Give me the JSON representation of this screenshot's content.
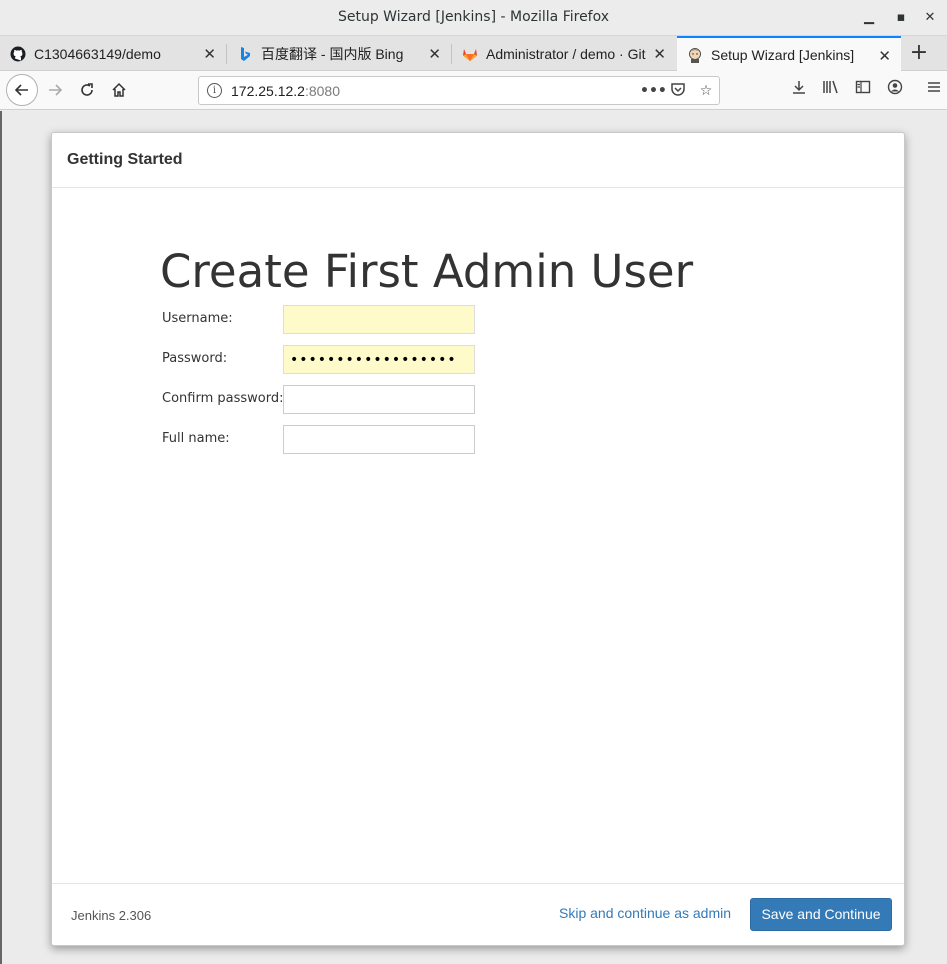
{
  "window": {
    "title": "Setup Wizard [Jenkins] - Mozilla Firefox"
  },
  "tabs": [
    {
      "label": "C1304663149/demo",
      "icon": "github-icon"
    },
    {
      "label": "百度翻译 - 国内版 Bing",
      "icon": "bing-icon"
    },
    {
      "label": "Administrator / demo · Git",
      "icon": "gitlab-icon"
    },
    {
      "label": "Setup Wizard [Jenkins]",
      "icon": "jenkins-icon",
      "active": true
    }
  ],
  "navbar": {
    "url_host": "172.25.12.2",
    "url_port": ":8080"
  },
  "page": {
    "header": "Getting Started",
    "heading": "Create First Admin User",
    "fields": {
      "username_label": "Username:",
      "password_label": "Password:",
      "password_value": "••••••••••••••••••",
      "confirm_label": "Confirm password:",
      "fullname_label": "Full name:"
    },
    "footer": {
      "version": "Jenkins 2.306",
      "skip_label": "Skip and continue as admin",
      "save_label": "Save and Continue"
    }
  },
  "colors": {
    "accent": "#337ab7",
    "autofill": "#fffac9",
    "active_tab_line": "#0a84ff"
  }
}
